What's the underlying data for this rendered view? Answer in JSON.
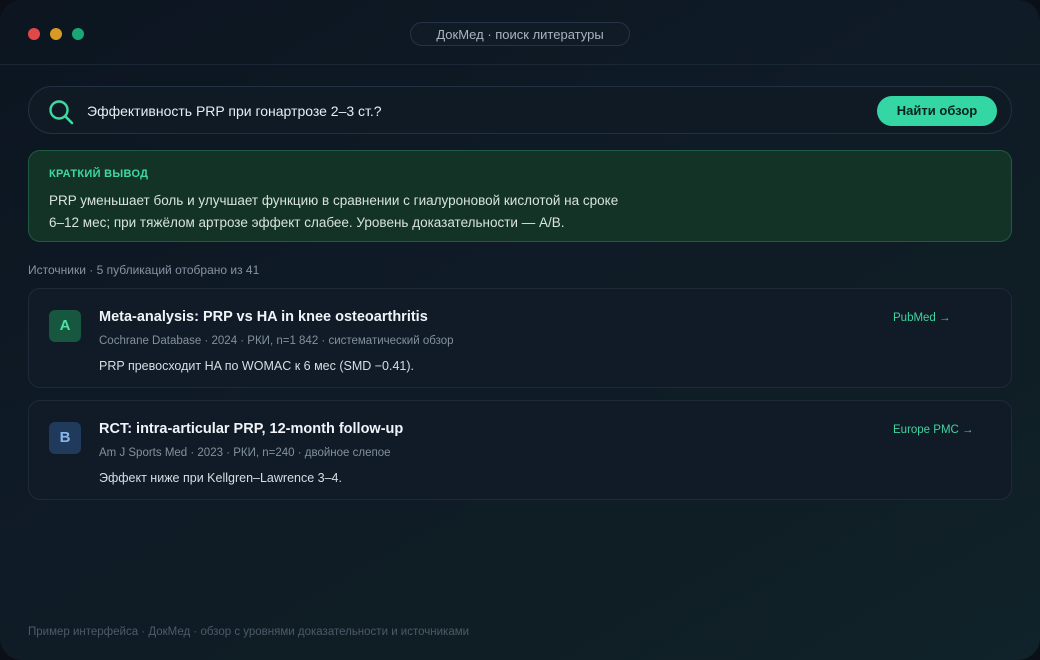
{
  "window": {
    "title": "ДокМед · поиск литературы"
  },
  "search": {
    "icon": "search-icon",
    "query": "Эффективность PRP при гонартрозе 2–3 ст.?",
    "button_label": "Найти обзор"
  },
  "summary": {
    "label": "КРАТКИЙ ВЫВОД",
    "line1": "PRP уменьшает боль и улучшает функцию в сравнении с гиалуроновой кислотой на сроке",
    "line2": "6–12 мес; при тяжёлом артрозе эффект слабее. Уровень доказательности — A/B."
  },
  "sources": {
    "header": "Источники · 5 публикаций отобрано из 41",
    "items": [
      {
        "grade": "A",
        "title": "Meta-analysis: PRP vs HA in knee osteoarthritis",
        "meta": "Cochrane Database · 2024 · РКИ, n=1 842 · систематический обзор",
        "finding": "PRP превосходит HA по WOMAC к 6 мес (SMD −0.41).",
        "link": "PubMed →"
      },
      {
        "grade": "B",
        "title": "RCT: intra-articular PRP, 12-month follow-up",
        "meta": "Am J Sports Med · 2023 · РКИ, n=240 · двойное слепое",
        "finding": "Эффект ниже при Kellgren–Lawrence 3–4.",
        "link": "Europe PMC →"
      }
    ]
  },
  "footer": {
    "text": "Пример интерфейса · ДокМед · обзор с уровнями доказательности и источниками"
  },
  "colors": {
    "accent": "#34d6a4",
    "grade_a": "#17563f",
    "grade_b": "#203a5c",
    "summary_bg": "#133326"
  }
}
